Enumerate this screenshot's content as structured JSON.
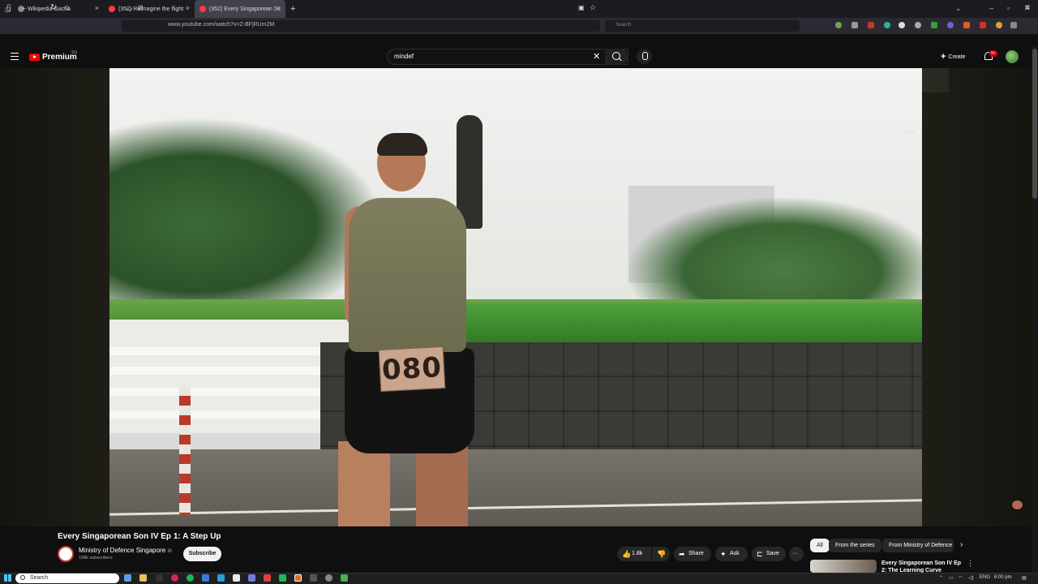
{
  "browser": {
    "tabs": [
      {
        "title": "Wikipedia Gacha",
        "fav_color": "#888888"
      },
      {
        "title": "(352) Relmagine the flight",
        "fav_color": "#ff0000"
      },
      {
        "title": "(352) Every Singaporean Sc",
        "fav_color": "#ff0000",
        "active": true
      }
    ],
    "new_tab_label": "+",
    "window_controls": [
      "–",
      "▫",
      "✕"
    ],
    "url": "www.youtube.com/watch?v=Z-BFjRUm2M",
    "search_placeholder": "Search"
  },
  "youtube": {
    "logo_text": "Premium",
    "logo_sup": "SG",
    "search_value": "mindef",
    "create_label": "Create",
    "notification_count": "9+",
    "video_overlay_text": "blood"
  },
  "video": {
    "bib_number": "080",
    "title": "Every Singaporean Son IV Ep 1: A Step Up",
    "channel_name": "Ministry of Defence Singapore",
    "channel_subscribers": "108k subscribers",
    "subscribe_label": "Subscribe",
    "like_count": "1.8k",
    "share_label": "Share",
    "ask_label": "Ask",
    "save_label": "Save",
    "more_label": "···"
  },
  "recommendations": {
    "chips": [
      "All",
      "From the series",
      "From Ministry of Defence"
    ],
    "first_title": "Every Singaporean Son IV Ep 2: The Learning Curve"
  },
  "taskbar": {
    "search_label": "Search",
    "lang": "ENG",
    "time": "6:00 pm"
  }
}
